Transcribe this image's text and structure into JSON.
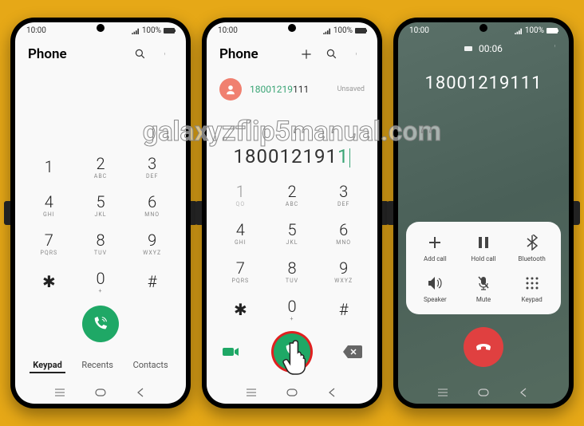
{
  "status": {
    "time": "10:00",
    "signal_pct": "100%",
    "battery_icon": "full"
  },
  "screen1": {
    "title": "Phone",
    "keypad": [
      {
        "num": "1",
        "sub": ""
      },
      {
        "num": "2",
        "sub": "ABC"
      },
      {
        "num": "3",
        "sub": "DEF"
      },
      {
        "num": "4",
        "sub": "GHI"
      },
      {
        "num": "5",
        "sub": "JKL"
      },
      {
        "num": "6",
        "sub": "MNO"
      },
      {
        "num": "7",
        "sub": "PQRS"
      },
      {
        "num": "8",
        "sub": "TUV"
      },
      {
        "num": "9",
        "sub": "WXYZ"
      },
      {
        "num": "✱",
        "sub": ""
      },
      {
        "num": "0",
        "sub": "+"
      },
      {
        "num": "#",
        "sub": ""
      }
    ],
    "tabs": {
      "keypad": "Keypad",
      "recents": "Recents",
      "contacts": "Contacts"
    }
  },
  "screen2": {
    "title": "Phone",
    "suggestion_match": "18001219",
    "suggestion_rest": "111",
    "suggestion_status": "Unsaved",
    "entered_number": "180012191",
    "keypad": [
      {
        "num": "1",
        "sub": "QO"
      },
      {
        "num": "2",
        "sub": "ABC"
      },
      {
        "num": "3",
        "sub": "DEF"
      },
      {
        "num": "4",
        "sub": "GHI"
      },
      {
        "num": "5",
        "sub": "JKL"
      },
      {
        "num": "6",
        "sub": "MNO"
      },
      {
        "num": "7",
        "sub": "PQRS"
      },
      {
        "num": "8",
        "sub": "TUV"
      },
      {
        "num": "9",
        "sub": "WXYZ"
      },
      {
        "num": "✱",
        "sub": ""
      },
      {
        "num": "0",
        "sub": "+"
      },
      {
        "num": "#",
        "sub": ""
      }
    ]
  },
  "screen3": {
    "timer": "00:06",
    "number": "18001219111",
    "controls": [
      {
        "label": "Add call",
        "icon": "plus"
      },
      {
        "label": "Hold call",
        "icon": "pause"
      },
      {
        "label": "Bluetooth",
        "icon": "bluetooth"
      },
      {
        "label": "Speaker",
        "icon": "speaker"
      },
      {
        "label": "Mute",
        "icon": "mute"
      },
      {
        "label": "Keypad",
        "icon": "keypad"
      }
    ]
  },
  "watermark": "galaxyzflip5manual.com"
}
